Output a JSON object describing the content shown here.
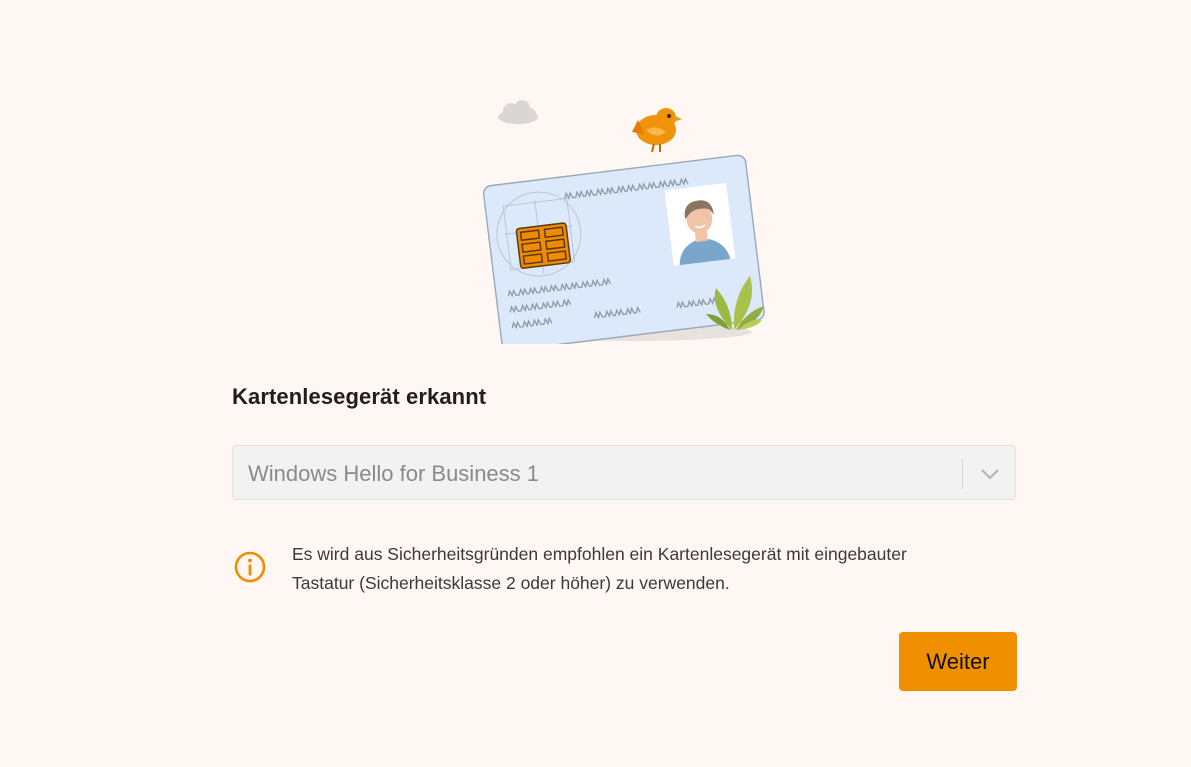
{
  "heading": "Kartenlesegerät erkannt",
  "reader_select": {
    "selected_value": "Windows Hello for Business 1"
  },
  "notice": {
    "line1": "Es wird aus Sicherheitsgründen empfohlen ein Kartenlesegerät mit eingebauter",
    "line2": "Tastatur (Sicherheitsklasse 2 oder höher) zu verwenden."
  },
  "actions": {
    "next_label": "Weiter"
  },
  "colors": {
    "accent": "#f09000",
    "background": "#fff7f3",
    "card": "#dbe9fb",
    "chip": "#f08a00"
  },
  "icons": {
    "info": "info-circle-icon",
    "dropdown": "chevron-down-icon"
  }
}
